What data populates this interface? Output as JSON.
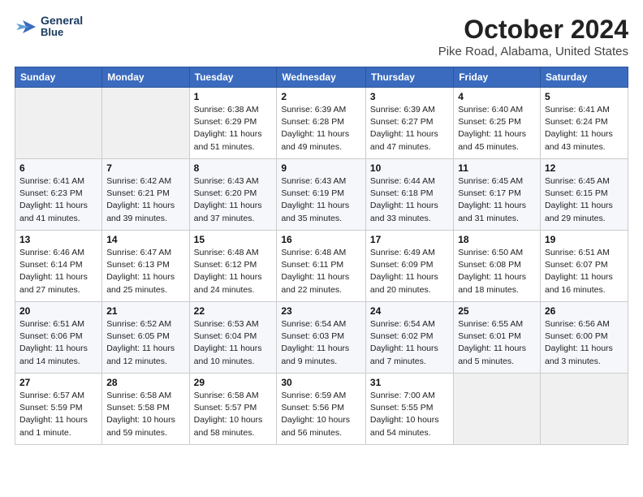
{
  "header": {
    "logo_line1": "General",
    "logo_line2": "Blue",
    "title": "October 2024",
    "subtitle": "Pike Road, Alabama, United States"
  },
  "calendar": {
    "weekdays": [
      "Sunday",
      "Monday",
      "Tuesday",
      "Wednesday",
      "Thursday",
      "Friday",
      "Saturday"
    ],
    "weeks": [
      [
        {
          "day": "",
          "info": ""
        },
        {
          "day": "",
          "info": ""
        },
        {
          "day": "1",
          "info": "Sunrise: 6:38 AM\nSunset: 6:29 PM\nDaylight: 11 hours and 51 minutes."
        },
        {
          "day": "2",
          "info": "Sunrise: 6:39 AM\nSunset: 6:28 PM\nDaylight: 11 hours and 49 minutes."
        },
        {
          "day": "3",
          "info": "Sunrise: 6:39 AM\nSunset: 6:27 PM\nDaylight: 11 hours and 47 minutes."
        },
        {
          "day": "4",
          "info": "Sunrise: 6:40 AM\nSunset: 6:25 PM\nDaylight: 11 hours and 45 minutes."
        },
        {
          "day": "5",
          "info": "Sunrise: 6:41 AM\nSunset: 6:24 PM\nDaylight: 11 hours and 43 minutes."
        }
      ],
      [
        {
          "day": "6",
          "info": "Sunrise: 6:41 AM\nSunset: 6:23 PM\nDaylight: 11 hours and 41 minutes."
        },
        {
          "day": "7",
          "info": "Sunrise: 6:42 AM\nSunset: 6:21 PM\nDaylight: 11 hours and 39 minutes."
        },
        {
          "day": "8",
          "info": "Sunrise: 6:43 AM\nSunset: 6:20 PM\nDaylight: 11 hours and 37 minutes."
        },
        {
          "day": "9",
          "info": "Sunrise: 6:43 AM\nSunset: 6:19 PM\nDaylight: 11 hours and 35 minutes."
        },
        {
          "day": "10",
          "info": "Sunrise: 6:44 AM\nSunset: 6:18 PM\nDaylight: 11 hours and 33 minutes."
        },
        {
          "day": "11",
          "info": "Sunrise: 6:45 AM\nSunset: 6:17 PM\nDaylight: 11 hours and 31 minutes."
        },
        {
          "day": "12",
          "info": "Sunrise: 6:45 AM\nSunset: 6:15 PM\nDaylight: 11 hours and 29 minutes."
        }
      ],
      [
        {
          "day": "13",
          "info": "Sunrise: 6:46 AM\nSunset: 6:14 PM\nDaylight: 11 hours and 27 minutes."
        },
        {
          "day": "14",
          "info": "Sunrise: 6:47 AM\nSunset: 6:13 PM\nDaylight: 11 hours and 25 minutes."
        },
        {
          "day": "15",
          "info": "Sunrise: 6:48 AM\nSunset: 6:12 PM\nDaylight: 11 hours and 24 minutes."
        },
        {
          "day": "16",
          "info": "Sunrise: 6:48 AM\nSunset: 6:11 PM\nDaylight: 11 hours and 22 minutes."
        },
        {
          "day": "17",
          "info": "Sunrise: 6:49 AM\nSunset: 6:09 PM\nDaylight: 11 hours and 20 minutes."
        },
        {
          "day": "18",
          "info": "Sunrise: 6:50 AM\nSunset: 6:08 PM\nDaylight: 11 hours and 18 minutes."
        },
        {
          "day": "19",
          "info": "Sunrise: 6:51 AM\nSunset: 6:07 PM\nDaylight: 11 hours and 16 minutes."
        }
      ],
      [
        {
          "day": "20",
          "info": "Sunrise: 6:51 AM\nSunset: 6:06 PM\nDaylight: 11 hours and 14 minutes."
        },
        {
          "day": "21",
          "info": "Sunrise: 6:52 AM\nSunset: 6:05 PM\nDaylight: 11 hours and 12 minutes."
        },
        {
          "day": "22",
          "info": "Sunrise: 6:53 AM\nSunset: 6:04 PM\nDaylight: 11 hours and 10 minutes."
        },
        {
          "day": "23",
          "info": "Sunrise: 6:54 AM\nSunset: 6:03 PM\nDaylight: 11 hours and 9 minutes."
        },
        {
          "day": "24",
          "info": "Sunrise: 6:54 AM\nSunset: 6:02 PM\nDaylight: 11 hours and 7 minutes."
        },
        {
          "day": "25",
          "info": "Sunrise: 6:55 AM\nSunset: 6:01 PM\nDaylight: 11 hours and 5 minutes."
        },
        {
          "day": "26",
          "info": "Sunrise: 6:56 AM\nSunset: 6:00 PM\nDaylight: 11 hours and 3 minutes."
        }
      ],
      [
        {
          "day": "27",
          "info": "Sunrise: 6:57 AM\nSunset: 5:59 PM\nDaylight: 11 hours and 1 minute."
        },
        {
          "day": "28",
          "info": "Sunrise: 6:58 AM\nSunset: 5:58 PM\nDaylight: 10 hours and 59 minutes."
        },
        {
          "day": "29",
          "info": "Sunrise: 6:58 AM\nSunset: 5:57 PM\nDaylight: 10 hours and 58 minutes."
        },
        {
          "day": "30",
          "info": "Sunrise: 6:59 AM\nSunset: 5:56 PM\nDaylight: 10 hours and 56 minutes."
        },
        {
          "day": "31",
          "info": "Sunrise: 7:00 AM\nSunset: 5:55 PM\nDaylight: 10 hours and 54 minutes."
        },
        {
          "day": "",
          "info": ""
        },
        {
          "day": "",
          "info": ""
        }
      ]
    ]
  }
}
